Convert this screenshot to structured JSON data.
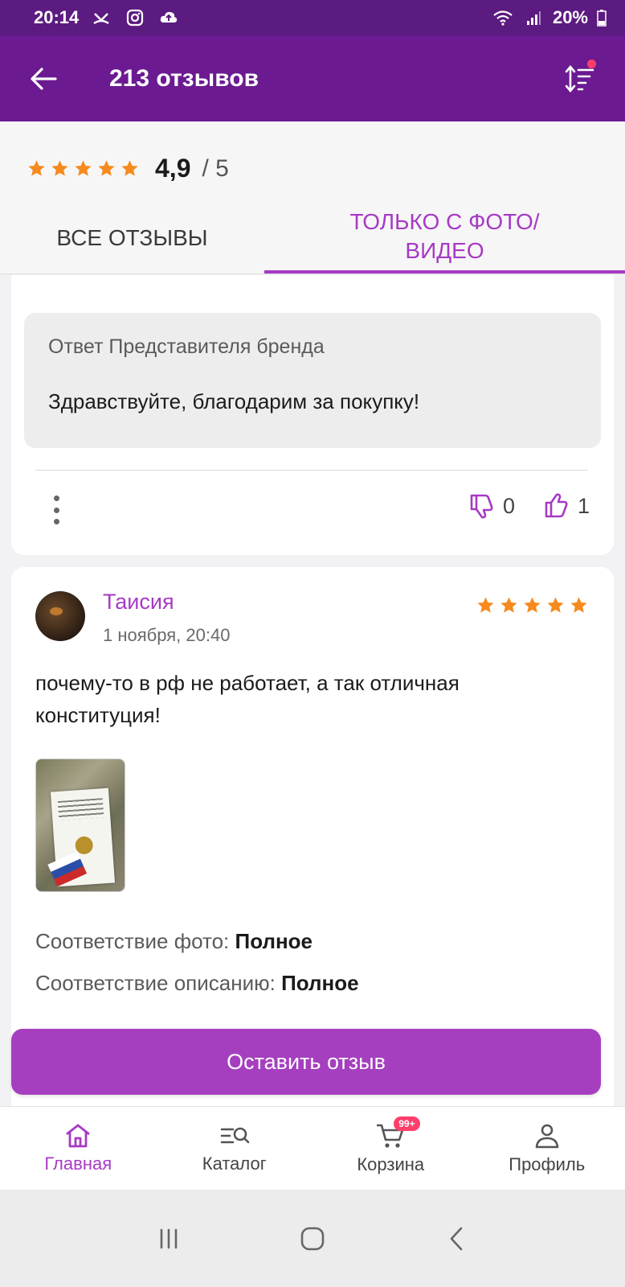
{
  "status_bar": {
    "time": "20:14",
    "battery": "20%"
  },
  "app_bar": {
    "title": "213 отзывов",
    "back_icon": "arrow-left-icon",
    "sort_icon": "sort-icon"
  },
  "rating": {
    "value": "4,9",
    "max": "/ 5",
    "stars": 5,
    "star_color": "#f68a1e"
  },
  "tabs": [
    {
      "label": "Все отзывы",
      "active": false
    },
    {
      "label": "Только с фото/ видео",
      "active": true
    }
  ],
  "review_1": {
    "brand_label": "Ответ Представителя бренда",
    "brand_text": "Здравствуйте, благодарим за покупку!",
    "dislikes": "0",
    "likes": "1"
  },
  "review_2": {
    "author": "Таисия",
    "date": "1 ноября, 20:40",
    "stars": 5,
    "text": "почему-то в рф не работает, а так отличная конституция!",
    "photo_match_label": "Соответствие фото:",
    "photo_match_value": "Полное",
    "desc_match_label": "Соответствие описанию:",
    "desc_match_value": "Полное"
  },
  "leave_review_button": "Оставить отзыв",
  "bottom_nav": [
    {
      "label": "Главная",
      "icon": "home-icon",
      "active": true
    },
    {
      "label": "Каталог",
      "icon": "catalog-search-icon",
      "active": false
    },
    {
      "label": "Корзина",
      "icon": "cart-icon",
      "active": false,
      "badge": "99+"
    },
    {
      "label": "Профиль",
      "icon": "profile-icon",
      "active": false
    }
  ],
  "colors": {
    "status_bar": "#5c1b80",
    "app_bar": "#6b1a91",
    "accent": "#a73ac4",
    "button": "#a53fbf",
    "badge": "#ff3d6b"
  }
}
